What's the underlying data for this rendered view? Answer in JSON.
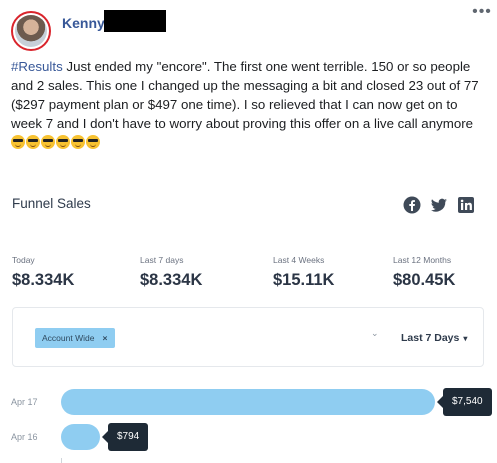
{
  "post": {
    "author": "Kenny",
    "hashtag": "#Results",
    "body": " Just ended my \"encore\". The first one went terrible. 150 or so people and 2 sales. This one I changed up the messaging a bit and closed 23 out of 77 ($297 payment plan or $497 one time). I so relieved that I can now get on to week 7 and I don't have to worry about proving this offer on a live call anymore ",
    "emoji_count": 6,
    "more_icon": "more-horizontal-icon"
  },
  "dashboard": {
    "title": "Funnel Sales",
    "social_icons": [
      "facebook-icon",
      "twitter-icon",
      "linkedin-icon"
    ],
    "stats": [
      {
        "label": "Today",
        "value": "$8.334K"
      },
      {
        "label": "Last 7 days",
        "value": "$8.334K"
      },
      {
        "label": "Last 4 Weeks",
        "value": "$15.11K"
      },
      {
        "label": "Last 12 Months",
        "value": "$80.45K"
      }
    ],
    "filter": {
      "chip_label": "Account Wide",
      "chip_remove": "×",
      "chevron": "⌄",
      "range_label": "Last 7 Days",
      "range_caret": "▾"
    }
  },
  "chart_data": {
    "type": "bar",
    "orientation": "horizontal",
    "categories": [
      "Apr 17",
      "Apr 16"
    ],
    "values": [
      7540,
      794
    ],
    "value_labels": [
      "$7,540",
      "$794"
    ],
    "colors": {
      "bar": "#8fcdf1",
      "tooltip": "#1e2a36"
    }
  }
}
